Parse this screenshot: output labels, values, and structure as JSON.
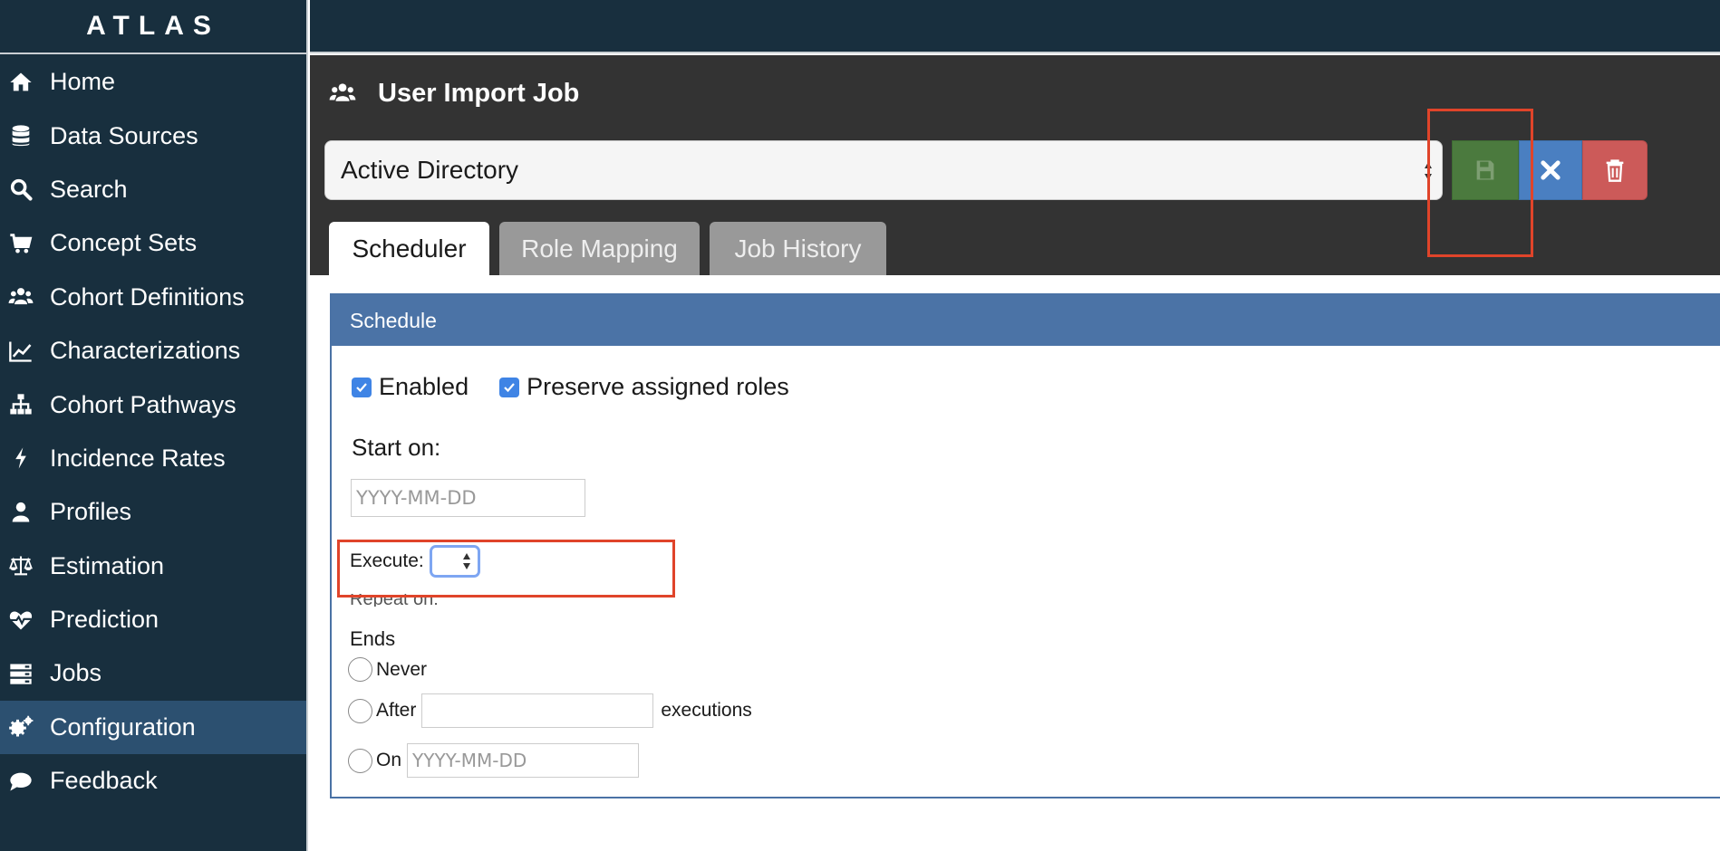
{
  "app": {
    "brand": "ATLAS"
  },
  "sidebar": {
    "items": [
      {
        "label": "Home",
        "icon": "home-icon"
      },
      {
        "label": "Data Sources",
        "icon": "database-icon"
      },
      {
        "label": "Search",
        "icon": "search-icon"
      },
      {
        "label": "Concept Sets",
        "icon": "cart-icon"
      },
      {
        "label": "Cohort Definitions",
        "icon": "users-icon"
      },
      {
        "label": "Characterizations",
        "icon": "line-chart-icon"
      },
      {
        "label": "Cohort Pathways",
        "icon": "sitemap-icon"
      },
      {
        "label": "Incidence Rates",
        "icon": "bolt-icon"
      },
      {
        "label": "Profiles",
        "icon": "user-icon"
      },
      {
        "label": "Estimation",
        "icon": "balance-scale-icon"
      },
      {
        "label": "Prediction",
        "icon": "heartbeat-icon"
      },
      {
        "label": "Jobs",
        "icon": "server-icon"
      },
      {
        "label": "Configuration",
        "icon": "cogs-icon",
        "active": true
      },
      {
        "label": "Feedback",
        "icon": "comment-icon"
      }
    ]
  },
  "header": {
    "title": "User Import Job",
    "title_icon": "users-icon",
    "provider_select": {
      "value": "Active Directory"
    },
    "buttons": {
      "save": {
        "icon": "floppy-disk-icon",
        "color": "#4b7a3e"
      },
      "cancel": {
        "icon": "close-icon",
        "color": "#4a7fc1"
      },
      "delete": {
        "icon": "trash-icon",
        "color": "#cc5a59"
      }
    },
    "tabs": [
      {
        "label": "Scheduler",
        "active": true
      },
      {
        "label": "Role Mapping",
        "active": false
      },
      {
        "label": "Job History",
        "active": false
      }
    ]
  },
  "schedule": {
    "heading": "Schedule",
    "enabled_label": "Enabled",
    "enabled_checked": true,
    "preserve_label": "Preserve assigned roles",
    "preserve_checked": true,
    "start_label": "Start on:",
    "start_placeholder": "YYYY-MM-DD",
    "execute_label": "Execute:",
    "repeat_label": "Repeat on:",
    "ends_label": "Ends",
    "ends_options": {
      "never": "Never",
      "after": "After",
      "after_suffix": "executions",
      "on": "On",
      "on_placeholder": "YYYY-MM-DD"
    }
  },
  "colors": {
    "sidebar_bg": "#182f3e",
    "sidebar_active": "#2c5070",
    "header_bg": "#333333",
    "panel_heading": "#4b73a6",
    "highlight": "#e0442a"
  }
}
